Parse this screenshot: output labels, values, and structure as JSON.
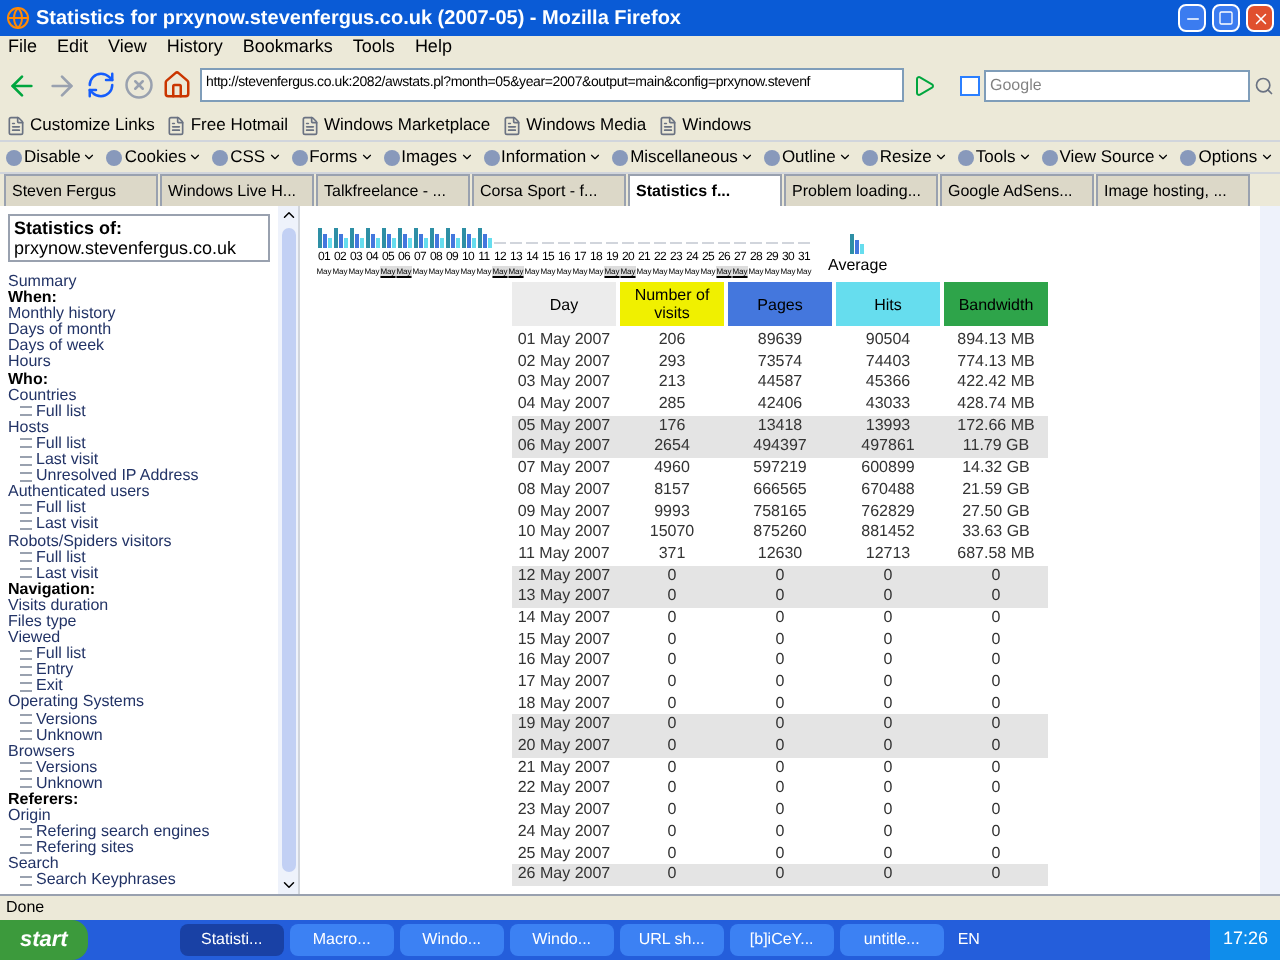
{
  "window": {
    "title": "Statistics for prxynow.stevenfergus.co.uk (2007-05) - Mozilla Firefox"
  },
  "menu": [
    "File",
    "Edit",
    "View",
    "History",
    "Bookmarks",
    "Tools",
    "Help"
  ],
  "address": {
    "value": "http://stevenfergus.co.uk:2082/awstats.pl?month=05&year=2007&output=main&config=prxynow.stevenf"
  },
  "search": {
    "placeholder": "Google"
  },
  "bookmarks": [
    "Customize Links",
    "Free Hotmail",
    "Windows Marketplace",
    "Windows Media",
    "Windows"
  ],
  "dev_toolbar": [
    "Disable",
    "Cookies",
    "CSS",
    "Forms",
    "Images",
    "Information",
    "Miscellaneous",
    "Outline",
    "Resize",
    "Tools",
    "View Source",
    "Options"
  ],
  "tabs": [
    {
      "label": "Steven Fergus",
      "selected": false
    },
    {
      "label": "Windows Live H...",
      "selected": false
    },
    {
      "label": "Talkfreelance - ...",
      "selected": false
    },
    {
      "label": "Corsa Sport - f...",
      "selected": false
    },
    {
      "label": "Statistics f...",
      "selected": true
    },
    {
      "label": "Problem loading...",
      "selected": false
    },
    {
      "label": "Google AdSens...",
      "selected": false
    },
    {
      "label": "Image hosting, ...",
      "selected": false
    }
  ],
  "sidebar": {
    "title": "Statistics of:",
    "site": "prxynow.stevenfergus.co.uk",
    "items": [
      {
        "kind": "link",
        "label": "Summary"
      },
      {
        "kind": "heading",
        "label": "When:"
      },
      {
        "kind": "link",
        "label": "Monthly history"
      },
      {
        "kind": "link",
        "label": "Days of month"
      },
      {
        "kind": "link",
        "label": "Days of week"
      },
      {
        "kind": "link",
        "label": "Hours"
      },
      {
        "kind": "heading",
        "label": "Who:"
      },
      {
        "kind": "link",
        "label": "Countries"
      },
      {
        "kind": "sub",
        "label": "Full list"
      },
      {
        "kind": "link",
        "label": "Hosts"
      },
      {
        "kind": "sub",
        "label": "Full list"
      },
      {
        "kind": "sub",
        "label": "Last visit"
      },
      {
        "kind": "sub",
        "label": "Unresolved IP Address"
      },
      {
        "kind": "link",
        "label": "Authenticated users"
      },
      {
        "kind": "sub",
        "label": "Full list"
      },
      {
        "kind": "sub",
        "label": "Last visit"
      },
      {
        "kind": "link",
        "label": "Robots/Spiders visitors"
      },
      {
        "kind": "sub",
        "label": "Full list"
      },
      {
        "kind": "sub",
        "label": "Last visit"
      },
      {
        "kind": "heading",
        "label": "Navigation:"
      },
      {
        "kind": "link",
        "label": "Visits duration"
      },
      {
        "kind": "link",
        "label": "Files type"
      },
      {
        "kind": "link",
        "label": "Viewed"
      },
      {
        "kind": "sub",
        "label": "Full list"
      },
      {
        "kind": "sub",
        "label": "Entry"
      },
      {
        "kind": "sub",
        "label": "Exit"
      },
      {
        "kind": "link",
        "label": "Operating Systems"
      },
      {
        "kind": "sub",
        "label": "Versions"
      },
      {
        "kind": "sub",
        "label": "Unknown"
      },
      {
        "kind": "link",
        "label": "Browsers"
      },
      {
        "kind": "sub",
        "label": "Versions"
      },
      {
        "kind": "sub",
        "label": "Unknown"
      },
      {
        "kind": "heading",
        "label": "Referers:"
      },
      {
        "kind": "link",
        "label": "Origin"
      },
      {
        "kind": "sub",
        "label": "Refering search engines"
      },
      {
        "kind": "sub",
        "label": "Refering sites"
      },
      {
        "kind": "link",
        "label": "Search"
      },
      {
        "kind": "sub",
        "label": "Search Keyphrases"
      }
    ]
  },
  "chart": {
    "average": "Average",
    "days": [
      {
        "day": "01",
        "month": "May",
        "weekend": false,
        "bars": true
      },
      {
        "day": "02",
        "month": "May",
        "weekend": false,
        "bars": true
      },
      {
        "day": "03",
        "month": "May",
        "weekend": false,
        "bars": true
      },
      {
        "day": "04",
        "month": "May",
        "weekend": false,
        "bars": true
      },
      {
        "day": "05",
        "month": "May",
        "weekend": true,
        "bars": true
      },
      {
        "day": "06",
        "month": "May",
        "weekend": true,
        "bars": true
      },
      {
        "day": "07",
        "month": "May",
        "weekend": false,
        "bars": true
      },
      {
        "day": "08",
        "month": "May",
        "weekend": false,
        "bars": true
      },
      {
        "day": "09",
        "month": "May",
        "weekend": false,
        "bars": true
      },
      {
        "day": "10",
        "month": "May",
        "weekend": false,
        "bars": true
      },
      {
        "day": "11",
        "month": "May",
        "weekend": false,
        "bars": true
      },
      {
        "day": "12",
        "month": "May",
        "weekend": true,
        "bars": false
      },
      {
        "day": "13",
        "month": "May",
        "weekend": true,
        "bars": false
      },
      {
        "day": "14",
        "month": "May",
        "weekend": false,
        "bars": false
      },
      {
        "day": "15",
        "month": "May",
        "weekend": false,
        "bars": false
      },
      {
        "day": "16",
        "month": "May",
        "weekend": false,
        "bars": false
      },
      {
        "day": "17",
        "month": "May",
        "weekend": false,
        "bars": false
      },
      {
        "day": "18",
        "month": "May",
        "weekend": false,
        "bars": false
      },
      {
        "day": "19",
        "month": "May",
        "weekend": true,
        "bars": false
      },
      {
        "day": "20",
        "month": "May",
        "weekend": true,
        "bars": false
      },
      {
        "day": "21",
        "month": "May",
        "weekend": false,
        "bars": false
      },
      {
        "day": "22",
        "month": "May",
        "weekend": false,
        "bars": false
      },
      {
        "day": "23",
        "month": "May",
        "weekend": false,
        "bars": false
      },
      {
        "day": "24",
        "month": "May",
        "weekend": false,
        "bars": false
      },
      {
        "day": "25",
        "month": "May",
        "weekend": false,
        "bars": false
      },
      {
        "day": "26",
        "month": "May",
        "weekend": true,
        "bars": false
      },
      {
        "day": "27",
        "month": "May",
        "weekend": true,
        "bars": false
      },
      {
        "day": "28",
        "month": "May",
        "weekend": false,
        "bars": false
      },
      {
        "day": "29",
        "month": "May",
        "weekend": false,
        "bars": false
      },
      {
        "day": "30",
        "month": "May",
        "weekend": false,
        "bars": false
      },
      {
        "day": "31",
        "month": "May",
        "weekend": false,
        "bars": false
      }
    ]
  },
  "table": {
    "columns": [
      {
        "label": "Day",
        "color": "#ececec"
      },
      {
        "label": "Number of visits",
        "color": "#f0f000"
      },
      {
        "label": "Pages",
        "color": "#4477dd"
      },
      {
        "label": "Hits",
        "color": "#66ddee"
      },
      {
        "label": "Bandwidth",
        "color": "#2ea44a"
      }
    ],
    "rows": [
      {
        "weekend": false,
        "cells": [
          "01 May 2007",
          "206",
          "89639",
          "90504",
          "894.13 MB"
        ]
      },
      {
        "weekend": false,
        "cells": [
          "02 May 2007",
          "293",
          "73574",
          "74403",
          "774.13 MB"
        ]
      },
      {
        "weekend": false,
        "cells": [
          "03 May 2007",
          "213",
          "44587",
          "45366",
          "422.42 MB"
        ]
      },
      {
        "weekend": false,
        "cells": [
          "04 May 2007",
          "285",
          "42406",
          "43033",
          "428.74 MB"
        ]
      },
      {
        "weekend": true,
        "cells": [
          "05 May 2007",
          "176",
          "13418",
          "13993",
          "172.66 MB"
        ]
      },
      {
        "weekend": true,
        "cells": [
          "06 May 2007",
          "2654",
          "494397",
          "497861",
          "11.79 GB"
        ]
      },
      {
        "weekend": false,
        "cells": [
          "07 May 2007",
          "4960",
          "597219",
          "600899",
          "14.32 GB"
        ]
      },
      {
        "weekend": false,
        "cells": [
          "08 May 2007",
          "8157",
          "666565",
          "670488",
          "21.59 GB"
        ]
      },
      {
        "weekend": false,
        "cells": [
          "09 May 2007",
          "9993",
          "758165",
          "762829",
          "27.50 GB"
        ]
      },
      {
        "weekend": false,
        "cells": [
          "10 May 2007",
          "15070",
          "875260",
          "881452",
          "33.63 GB"
        ]
      },
      {
        "weekend": false,
        "cells": [
          "11 May 2007",
          "371",
          "12630",
          "12713",
          "687.58 MB"
        ]
      },
      {
        "weekend": true,
        "cells": [
          "12 May 2007",
          "0",
          "0",
          "0",
          "0"
        ]
      },
      {
        "weekend": true,
        "cells": [
          "13 May 2007",
          "0",
          "0",
          "0",
          "0"
        ]
      },
      {
        "weekend": false,
        "cells": [
          "14 May 2007",
          "0",
          "0",
          "0",
          "0"
        ]
      },
      {
        "weekend": false,
        "cells": [
          "15 May 2007",
          "0",
          "0",
          "0",
          "0"
        ]
      },
      {
        "weekend": false,
        "cells": [
          "16 May 2007",
          "0",
          "0",
          "0",
          "0"
        ]
      },
      {
        "weekend": false,
        "cells": [
          "17 May 2007",
          "0",
          "0",
          "0",
          "0"
        ]
      },
      {
        "weekend": false,
        "cells": [
          "18 May 2007",
          "0",
          "0",
          "0",
          "0"
        ]
      },
      {
        "weekend": true,
        "cells": [
          "19 May 2007",
          "0",
          "0",
          "0",
          "0"
        ]
      },
      {
        "weekend": true,
        "cells": [
          "20 May 2007",
          "0",
          "0",
          "0",
          "0"
        ]
      },
      {
        "weekend": false,
        "cells": [
          "21 May 2007",
          "0",
          "0",
          "0",
          "0"
        ]
      },
      {
        "weekend": false,
        "cells": [
          "22 May 2007",
          "0",
          "0",
          "0",
          "0"
        ]
      },
      {
        "weekend": false,
        "cells": [
          "23 May 2007",
          "0",
          "0",
          "0",
          "0"
        ]
      },
      {
        "weekend": false,
        "cells": [
          "24 May 2007",
          "0",
          "0",
          "0",
          "0"
        ]
      },
      {
        "weekend": false,
        "cells": [
          "25 May 2007",
          "0",
          "0",
          "0",
          "0"
        ]
      },
      {
        "weekend": true,
        "cells": [
          "26 May 2007",
          "0",
          "0",
          "0",
          "0"
        ]
      }
    ]
  },
  "status_bar": {
    "text": "Done"
  },
  "taskbar": {
    "start": "start",
    "items": [
      {
        "label": "Statisti...",
        "selected": true
      },
      {
        "label": "Macro...",
        "selected": false
      },
      {
        "label": "Windo...",
        "selected": false
      },
      {
        "label": "Windo...",
        "selected": false
      },
      {
        "label": "URL sh...",
        "selected": false
      },
      {
        "label": "[b]iCeY...",
        "selected": false
      },
      {
        "label": "untitle...",
        "selected": false
      }
    ],
    "language": "EN",
    "clock": "17:26"
  }
}
